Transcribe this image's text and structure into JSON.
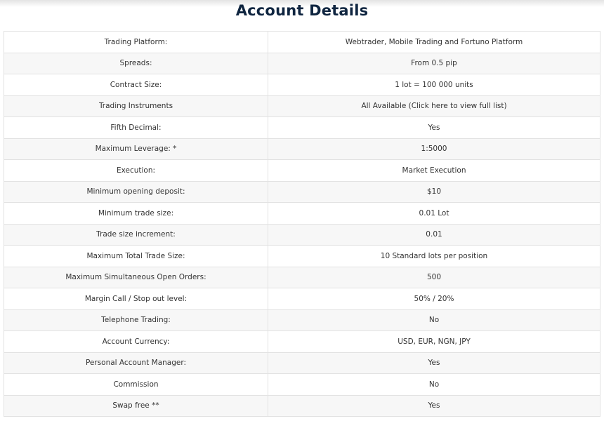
{
  "page": {
    "title": "Account Details"
  },
  "rows": [
    {
      "label": "Trading Platform:",
      "value": "Webtrader, Mobile Trading and Fortuno Platform"
    },
    {
      "label": "Spreads:",
      "value": "From 0.5 pip"
    },
    {
      "label": "Contract Size:",
      "value": "1 lot = 100 000 units"
    },
    {
      "label": "Trading Instruments",
      "value": "All Available (Click here to view full list)"
    },
    {
      "label": "Fifth Decimal:",
      "value": "Yes"
    },
    {
      "label": "Maximum Leverage: *",
      "value": "1:5000"
    },
    {
      "label": "Execution:",
      "value": "Market Execution"
    },
    {
      "label": "Minimum opening deposit:",
      "value": "$10"
    },
    {
      "label": "Minimum trade size:",
      "value": "0.01 Lot"
    },
    {
      "label": "Trade size increment:",
      "value": "0.01"
    },
    {
      "label": "Maximum Total Trade Size:",
      "value": "10 Standard lots per position"
    },
    {
      "label": "Maximum Simultaneous Open Orders:",
      "value": "500"
    },
    {
      "label": "Margin Call / Stop out level:",
      "value": "50% / 20%"
    },
    {
      "label": "Telephone Trading:",
      "value": "No"
    },
    {
      "label": "Account Currency:",
      "value": "USD, EUR, NGN, JPY"
    },
    {
      "label": "Personal Account Manager:",
      "value": "Yes"
    },
    {
      "label": "Commission",
      "value": "No"
    },
    {
      "label": "Swap free **",
      "value": "Yes"
    }
  ]
}
